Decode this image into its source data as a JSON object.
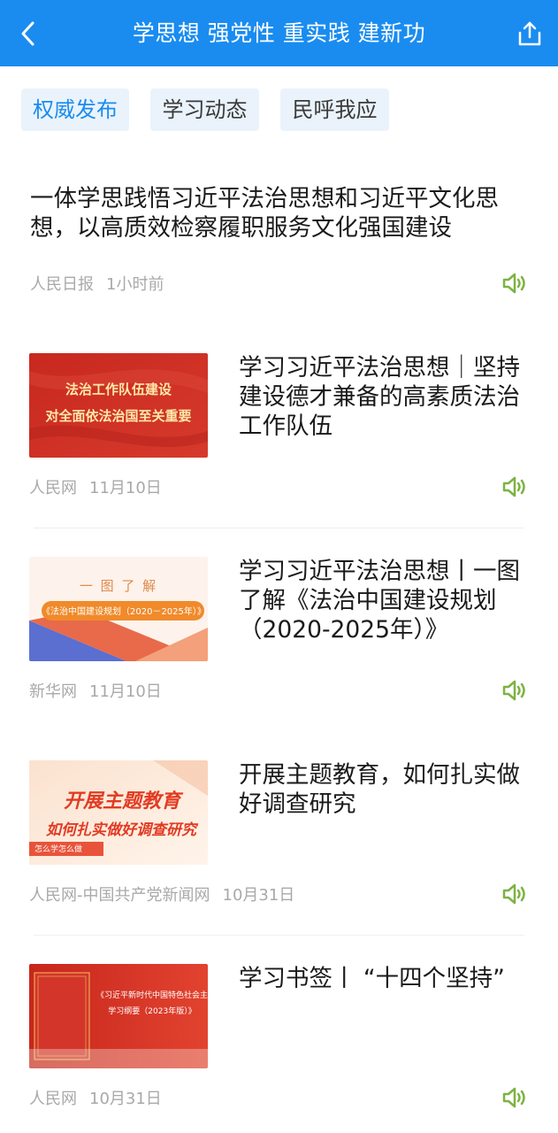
{
  "header": {
    "title": "学思想 强党性 重实践 建新功",
    "back_icon": "back-arrow-icon",
    "share_icon": "share-icon",
    "bg_color": "#1a8cf0"
  },
  "tabs": [
    {
      "label": "权威发布",
      "active": true
    },
    {
      "label": "学习动态",
      "active": false
    },
    {
      "label": "民呼我应",
      "active": false
    }
  ],
  "articles": [
    {
      "title": "一体学思践悟习近平法治思想和习近平文化思想，以高质效检察履职服务文化强国建设",
      "source": "人民日报",
      "time": "1小时前"
    },
    {
      "title": "学习习近平法治思想｜坚持建设德才兼备的高素质法治工作队伍",
      "source": "人民网",
      "time": "11月10日",
      "thumb": {
        "line1": "法治工作队伍建设",
        "line2": "对全面依法治国至关重要"
      }
    },
    {
      "title": "学习习近平法治思想丨一图了解《法治中国建设规划（2020-2025年）》",
      "source": "新华网",
      "time": "11月10日",
      "thumb": {
        "line1": "一 图 了 解",
        "line2": "《法治中国建设规划（2020－2025年）》"
      }
    },
    {
      "title": "开展主题教育，如何扎实做好调查研究",
      "source": "人民网-中国共产党新闻网",
      "time": "10月31日",
      "thumb": {
        "line1": "开展主题教育",
        "line2": "如何扎实做好调查研究",
        "line3": "怎么学怎么做"
      }
    },
    {
      "title": "学习书签丨 “十四个坚持”",
      "source": "人民网",
      "time": "10月31日",
      "thumb": {
        "line1": "《习近平新时代中国特色社会主",
        "line2": "学习纲要（2023年版）》"
      }
    }
  ],
  "speaker_icon": "speaker-icon",
  "speaker_color": "#7cb342"
}
